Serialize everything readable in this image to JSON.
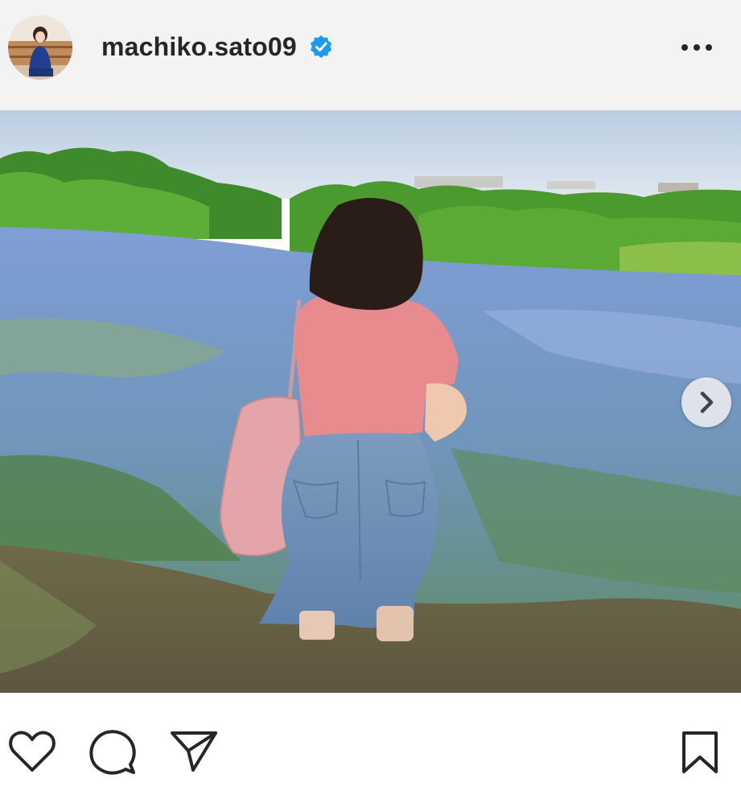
{
  "post": {
    "username": "machiko.sato09",
    "verified": true,
    "verified_icon": "verified-badge-icon",
    "more_icon": "more-options-icon"
  },
  "carousel": {
    "slide_count": 4,
    "active_index": 0,
    "next_icon": "chevron-right-icon"
  },
  "actions": {
    "like_icon": "heart-icon",
    "comment_icon": "comment-icon",
    "share_icon": "send-icon",
    "save_icon": "bookmark-icon"
  },
  "colors": {
    "verified_blue": "#1d9bf0",
    "text_dark": "#262626",
    "header_bg": "#f3f3f3"
  }
}
